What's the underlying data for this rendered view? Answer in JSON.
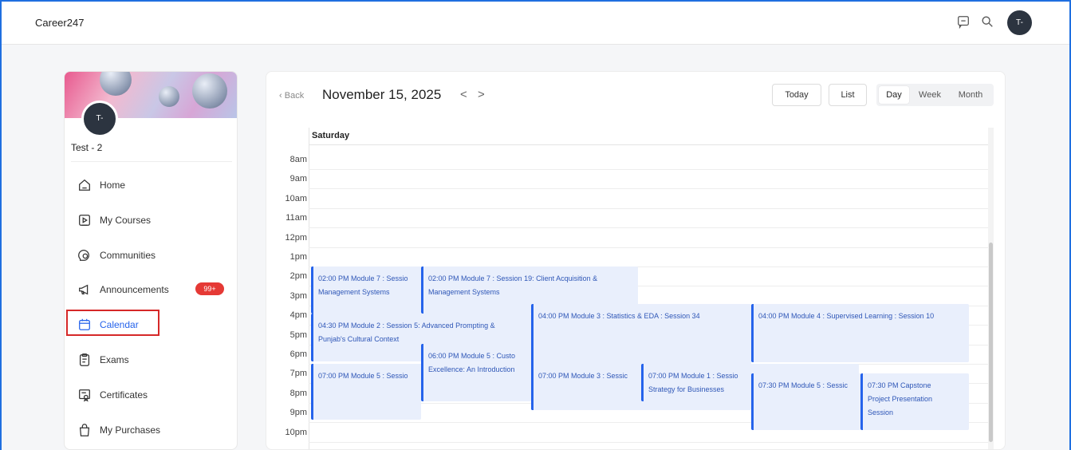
{
  "app": {
    "brand": "Career247"
  },
  "topbar": {
    "icons": [
      "chat-icon",
      "search-icon"
    ],
    "avatar_initials": "T-"
  },
  "sidebar": {
    "avatar_initials": "T-",
    "user_name": "Test - 2",
    "items": [
      {
        "label": "Home",
        "icon": "home-icon"
      },
      {
        "label": "My Courses",
        "icon": "courses-icon"
      },
      {
        "label": "Communities",
        "icon": "communities-icon"
      },
      {
        "label": "Announcements",
        "icon": "megaphone-icon",
        "badge": "99+"
      },
      {
        "label": "Calendar",
        "icon": "calendar-icon",
        "active": true
      },
      {
        "label": "Exams",
        "icon": "exams-icon"
      },
      {
        "label": "Certificates",
        "icon": "certificate-icon"
      },
      {
        "label": "My Purchases",
        "icon": "bag-icon"
      }
    ]
  },
  "calendar": {
    "back_label": "Back",
    "date_title": "November 15, 2025",
    "prev_symbol": "<",
    "next_symbol": ">",
    "today_label": "Today",
    "list_label": "List",
    "views": [
      "Day",
      "Week",
      "Month"
    ],
    "active_view": "Day",
    "day_header": "Saturday",
    "hours": [
      "8am",
      "9am",
      "10am",
      "11am",
      "12pm",
      "1pm",
      "2pm",
      "3pm",
      "4pm",
      "5pm",
      "6pm",
      "7pm",
      "8pm",
      "9pm",
      "10pm"
    ],
    "events": [
      {
        "l1": "02:00 PM Module 7 : Sessio",
        "l2": "Management Systems"
      },
      {
        "l1": "02:00 PM Module 7 : Session 19: Client Acquisition &",
        "l2": "Management Systems"
      },
      {
        "l1": "04:00 PM Module 3 : Statistics & EDA : Session 34",
        "l2": ""
      },
      {
        "l1": "04:00 PM Module 4 : Supervised Learning : Session 10",
        "l2": ""
      },
      {
        "l1": "04:30 PM Module 2 : Session 5: Advanced Prompting &",
        "l2": "Punjab's Cultural Context"
      },
      {
        "l1": "06:00 PM Module 5 : Custo",
        "l2": "Excellence: An Introduction"
      },
      {
        "l1": "07:00 PM Module 5 : Sessio",
        "l2": ""
      },
      {
        "l1": "07:00 PM Module 3 : Sessic",
        "l2": ""
      },
      {
        "l1": "07:00 PM Module 1 : Sessio",
        "l2": "Strategy for Businesses"
      },
      {
        "l1": "07:30 PM Module 5 : Sessic",
        "l2": ""
      },
      {
        "l1": "07:30 PM Capstone",
        "l2": "Project Presentation",
        "l3": "Session"
      }
    ]
  },
  "colors": {
    "accent": "#2563eb",
    "event_bg": "#e9effc",
    "badge": "#e53935",
    "highlight": "#d62828"
  }
}
